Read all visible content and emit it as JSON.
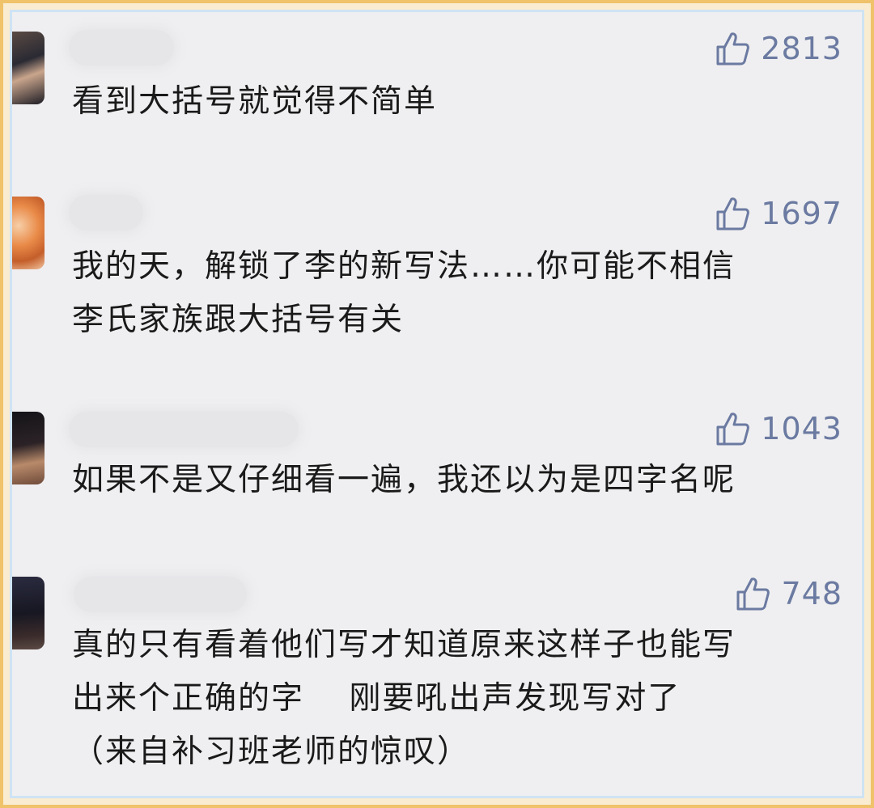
{
  "comments": [
    {
      "likes": "2813",
      "text": "看到大括号就觉得不简单"
    },
    {
      "likes": "1697",
      "text": "我的天，解锁了李的新写法……你可能不相信\n李氏家族跟大括号有关"
    },
    {
      "likes": "1043",
      "text": "如果不是又仔细看一遍，我还以为是四字名呢"
    },
    {
      "likes": "748",
      "text": "真的只有看着他们写才知道原来这样子也能写\n出来个正确的字　 刚要吼出声发现写对了\n（来自补习班老师的惊叹）"
    }
  ],
  "icons": {
    "like": "thumbs-up-icon"
  },
  "colors": {
    "accent": "#6b7aa1",
    "frame": "#f0c26a",
    "background": "#efeff1"
  }
}
